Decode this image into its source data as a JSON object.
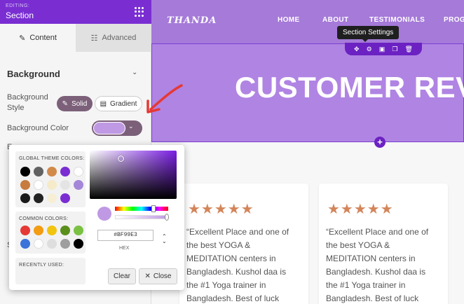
{
  "sidebar": {
    "editing_label": "EDITING:",
    "title": "Section",
    "tabs": [
      {
        "label": "Content"
      },
      {
        "label": "Advanced"
      }
    ],
    "section_title": "Background",
    "bg_style_label": "Background Style",
    "bg_style_options": [
      "Solid",
      "Gradient"
    ],
    "bg_color_label": "Background Color",
    "peek_letter_1": "E",
    "peek_letter_2": "S"
  },
  "colors": {
    "brand": "#7a2ed2",
    "selected": "#bf99e3",
    "star": "#d3855a"
  },
  "picker": {
    "global_label": "GLOBAL THEME COLORS:",
    "common_label": "COMMON COLORS:",
    "recent_label": "RECENTLY USED:",
    "hex_value": "#BF99E3",
    "hex_label": "HEX",
    "clear": "Clear",
    "close": "Close",
    "global_colors": [
      "#000000",
      "#616161",
      "#d28a4a",
      "#7a2ed2",
      "#ffffff",
      "#c77b3e",
      "#ffffff",
      "#f5ebc9",
      "#e4e4e4",
      "#a587d9",
      "#1a1a1a",
      "#222222",
      "#f6efd6",
      "#7a2ed2"
    ],
    "common_colors": [
      "#e53935",
      "#f39c12",
      "#f1c40f",
      "#5a8f1c",
      "#7ac142",
      "#3a73d9",
      "#ffffff",
      "#dedede",
      "#9e9e9e",
      "#000000"
    ]
  },
  "site": {
    "logo": "THANDA",
    "nav": [
      "HOME",
      "ABOUT",
      "TESTIMONIALS",
      "PROG"
    ],
    "hero_title": "CUSTOMER REVI",
    "tooltip": "Section Settings",
    "stars": "★★★★★",
    "reviews": [
      {
        "text": "“Excellent Place and one of the best YOGA & MEDITATION centers in Bangladesh. Kushol daa is the #1 Yoga trainer in Bangladesh. Best of luck forever”"
      },
      {
        "text": "“Excellent Place and one of the best YOGA & MEDITATION centers in Bangladesh. Kushol daa is the #1 Yoga trainer in Bangladesh. Best of luck forever”"
      }
    ]
  }
}
